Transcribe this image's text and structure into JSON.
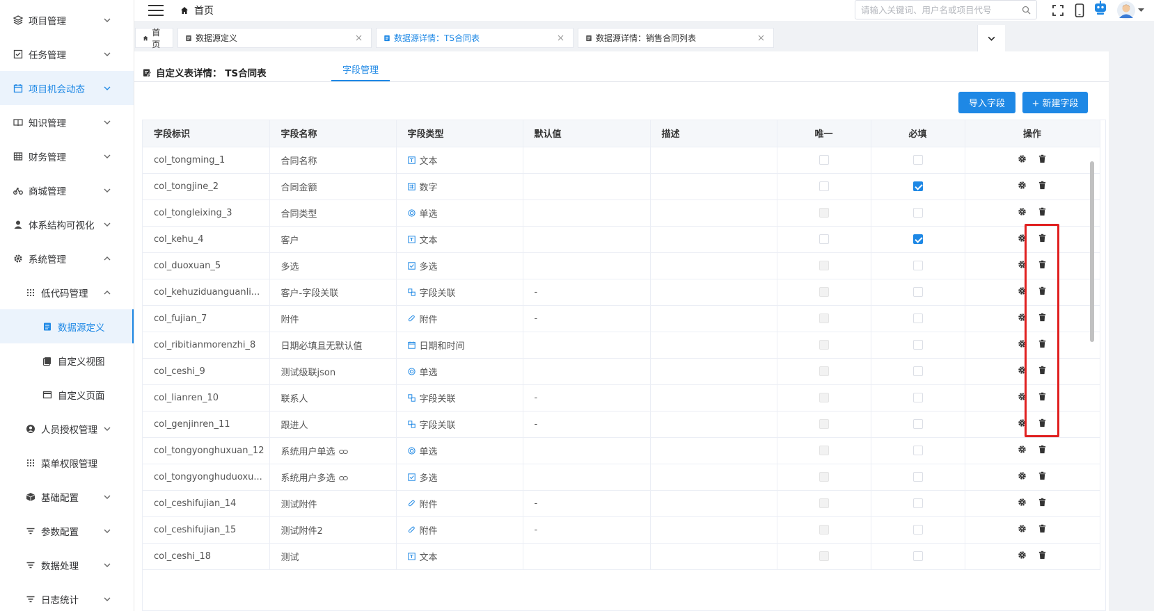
{
  "sidebar": {
    "items": [
      {
        "label": "项目管理",
        "icon": "layers-icon"
      },
      {
        "label": "任务管理",
        "icon": "checkbox-icon"
      },
      {
        "label": "项目机会动态",
        "icon": "calendar-icon"
      },
      {
        "label": "知识管理",
        "icon": "book-icon"
      },
      {
        "label": "财务管理",
        "icon": "grid-icon"
      },
      {
        "label": "商城管理",
        "icon": "bike-icon"
      },
      {
        "label": "体系结构可视化",
        "icon": "user-icon"
      },
      {
        "label": "系统管理",
        "icon": "gear-icon"
      },
      {
        "label": "低代码管理",
        "icon": "apps-icon"
      },
      {
        "label": "数据源定义",
        "icon": "doc-icon"
      },
      {
        "label": "自定义视图",
        "icon": "view-icon"
      },
      {
        "label": "自定义页面",
        "icon": "window-icon"
      },
      {
        "label": "人员授权管理",
        "icon": "user-circle-icon"
      },
      {
        "label": "菜单权限管理",
        "icon": "apps-icon"
      },
      {
        "label": "基础配置",
        "icon": "cube-icon"
      },
      {
        "label": "参数配置",
        "icon": "filter-icon"
      },
      {
        "label": "数据处理",
        "icon": "filter-icon"
      },
      {
        "label": "日志统计",
        "icon": "filter-icon"
      }
    ]
  },
  "header": {
    "breadcrumb": "首页",
    "search_placeholder": "请输入关键词、用户名或项目代号"
  },
  "tabs": [
    {
      "label": "首页"
    },
    {
      "label": "数据源定义"
    },
    {
      "label": "数据源详情：TS合同表"
    },
    {
      "label": "数据源详情：销售合同列表"
    }
  ],
  "page": {
    "title": "自定义表详情： TS合同表",
    "tab": "字段管理",
    "import_button": "导入字段",
    "new_button": "+ 新建字段"
  },
  "table": {
    "columns": [
      "字段标识",
      "字段名称",
      "字段类型",
      "默认值",
      "描述",
      "唯一",
      "必填",
      "操作"
    ],
    "rows": [
      {
        "id": "col_tongming_1",
        "name": "合同名称",
        "type": "文本",
        "type_icon": "text",
        "default": "",
        "unique": "off",
        "required": "off"
      },
      {
        "id": "col_tongjine_2",
        "name": "合同金额",
        "type": "数字",
        "type_icon": "number",
        "default": "",
        "unique": "off",
        "required": "on"
      },
      {
        "id": "col_tongleixing_3",
        "name": "合同类型",
        "type": "单选",
        "type_icon": "radio",
        "default": "",
        "unique": "disabled",
        "required": "off"
      },
      {
        "id": "col_kehu_4",
        "name": "客户",
        "type": "文本",
        "type_icon": "text",
        "default": "",
        "unique": "off",
        "required": "on"
      },
      {
        "id": "col_duoxuan_5",
        "name": "多选",
        "type": "多选",
        "type_icon": "check",
        "default": "",
        "unique": "disabled",
        "required": "off"
      },
      {
        "id": "col_kehuziduanguanli...",
        "name": "客户-字段关联",
        "type": "字段关联",
        "type_icon": "link",
        "default": "-",
        "unique": "disabled",
        "required": "off"
      },
      {
        "id": "col_fujian_7",
        "name": "附件",
        "type": "附件",
        "type_icon": "clip",
        "default": "-",
        "unique": "disabled",
        "required": "off"
      },
      {
        "id": "col_ribitianmorenzhi_8",
        "name": "日期必填且无默认值",
        "type": "日期和时间",
        "type_icon": "date",
        "default": "",
        "unique": "disabled",
        "required": "off"
      },
      {
        "id": "col_ceshi_9",
        "name": "测试级联json",
        "type": "单选",
        "type_icon": "radio",
        "default": "",
        "unique": "disabled",
        "required": "off"
      },
      {
        "id": "col_lianren_10",
        "name": "联系人",
        "type": "字段关联",
        "type_icon": "link",
        "default": "-",
        "unique": "disabled",
        "required": "off"
      },
      {
        "id": "col_genjinren_11",
        "name": "跟进人",
        "type": "字段关联",
        "type_icon": "link",
        "default": "-",
        "unique": "disabled",
        "required": "off"
      },
      {
        "id": "col_tongyonghuxuan_12",
        "name": "系统用户单选",
        "name_link": true,
        "type": "单选",
        "type_icon": "radio",
        "default": "",
        "unique": "disabled",
        "required": "off"
      },
      {
        "id": "col_tongyonghuduoxu...",
        "name": "系统用户多选",
        "name_link": true,
        "type": "多选",
        "type_icon": "check",
        "default": "",
        "unique": "disabled",
        "required": "off"
      },
      {
        "id": "col_ceshifujian_14",
        "name": "测试附件",
        "type": "附件",
        "type_icon": "clip",
        "default": "-",
        "unique": "disabled",
        "required": "off"
      },
      {
        "id": "col_ceshifujian_15",
        "name": "测试附件2",
        "type": "附件",
        "type_icon": "clip",
        "default": "-",
        "unique": "disabled",
        "required": "off"
      },
      {
        "id": "col_ceshi_18",
        "name": "测试",
        "type": "文本",
        "type_icon": "text",
        "default": "",
        "unique": "disabled",
        "required": "off"
      }
    ]
  },
  "colors": {
    "accent": "#1e88e5",
    "highlight_box": "#e02020"
  }
}
